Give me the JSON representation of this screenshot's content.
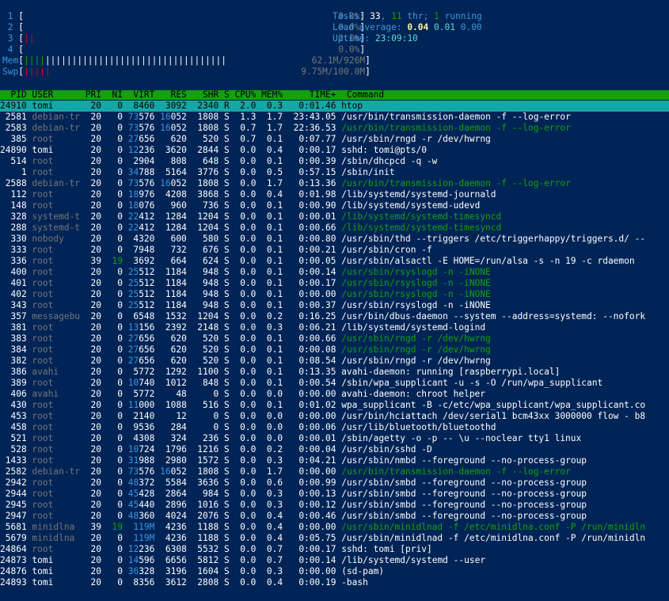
{
  "meters": {
    "cpus": [
      {
        "n": "1",
        "bar": "",
        "pct": "0.0%"
      },
      {
        "n": "2",
        "bar": "",
        "pct": "0.0%"
      },
      {
        "n": "3",
        "bar": "||",
        "pct": "2.0%"
      },
      {
        "n": "4",
        "bar": "",
        "pct": "0.0%"
      }
    ],
    "mem": {
      "label": "Mem",
      "bar": "||||||||||||||||||||||||||||||||||||||",
      "value": "62.1M/926M"
    },
    "swp": {
      "label": "Swp",
      "bar": "|||||",
      "value": "9.75M/100.0M"
    }
  },
  "summary": {
    "tasks_label": "Tasks:",
    "tasks": "33",
    "thr": "11",
    "thr_label": "thr;",
    "running": "1",
    "running_label": "running",
    "load_label": "Load average:",
    "load1": "0.04",
    "load5": "0.01",
    "load15": "0.00",
    "uptime_label": "Uptime:",
    "uptime": "23:09:10"
  },
  "columns": [
    "PID",
    "USER",
    "PRI",
    "NI",
    "VIRT",
    "RES",
    "SHR",
    "S",
    "CPU%",
    "MEM%",
    "TIME+",
    "Command"
  ],
  "processes": [
    [
      "24910",
      "tomi",
      "20",
      "0",
      "8460",
      "3092",
      "2340",
      "R",
      "2.0",
      "0.3",
      "0:01.46",
      "htop"
    ],
    [
      "2581",
      "debian-tr",
      "20",
      "0",
      "73576",
      "16052",
      "1808",
      "S",
      "1.3",
      "1.7",
      "23:43.05",
      "/usr/bin/transmission-daemon -f --log-error"
    ],
    [
      "2583",
      "debian-tr",
      "20",
      "0",
      "73576",
      "16052",
      "1808",
      "S",
      "0.7",
      "1.7",
      "22:36.53",
      "/usr/bin/transmission-daemon -f --log-error"
    ],
    [
      "385",
      "root",
      "20",
      "0",
      "27656",
      "620",
      "520",
      "S",
      "0.7",
      "0.1",
      "0:07.77",
      "/usr/sbin/rngd -r /dev/hwrng"
    ],
    [
      "24890",
      "tomi",
      "20",
      "0",
      "12236",
      "3620",
      "2844",
      "S",
      "0.0",
      "0.4",
      "0:00.17",
      "sshd: tomi@pts/0"
    ],
    [
      "514",
      "root",
      "20",
      "0",
      "2904",
      "808",
      "648",
      "S",
      "0.0",
      "0.1",
      "0:00.39",
      "/sbin/dhcpcd -q -w"
    ],
    [
      "1",
      "root",
      "20",
      "0",
      "34788",
      "5164",
      "3776",
      "S",
      "0.0",
      "0.5",
      "0:57.15",
      "/sbin/init"
    ],
    [
      "2588",
      "debian-tr",
      "20",
      "0",
      "73576",
      "16052",
      "1808",
      "S",
      "0.0",
      "1.7",
      "0:13.36",
      "/usr/bin/transmission-daemon -f --log-error"
    ],
    [
      "112",
      "root",
      "20",
      "0",
      "18976",
      "4208",
      "3868",
      "S",
      "0.0",
      "0.4",
      "0:01.98",
      "/lib/systemd/systemd-journald"
    ],
    [
      "148",
      "root",
      "20",
      "0",
      "18076",
      "960",
      "736",
      "S",
      "0.0",
      "0.1",
      "0:00.90",
      "/lib/systemd/systemd-udevd"
    ],
    [
      "328",
      "systemd-t",
      "20",
      "0",
      "22412",
      "1284",
      "1204",
      "S",
      "0.0",
      "0.1",
      "0:00.01",
      "/lib/systemd/systemd-timesyncd"
    ],
    [
      "288",
      "systemd-t",
      "20",
      "0",
      "22412",
      "1284",
      "1204",
      "S",
      "0.0",
      "0.1",
      "0:00.66",
      "/lib/systemd/systemd-timesyncd"
    ],
    [
      "330",
      "nobody",
      "20",
      "0",
      "4320",
      "600",
      "580",
      "S",
      "0.0",
      "0.1",
      "0:00.80",
      "/usr/sbin/thd --triggers /etc/triggerhappy/triggers.d/ --"
    ],
    [
      "333",
      "root",
      "20",
      "0",
      "7948",
      "732",
      "676",
      "S",
      "0.0",
      "0.1",
      "0:00.21",
      "/usr/sbin/cron -f"
    ],
    [
      "336",
      "root",
      "39",
      "19",
      "3692",
      "664",
      "624",
      "S",
      "0.0",
      "0.1",
      "0:00.05",
      "/usr/sbin/alsactl -E HOME=/run/alsa -s -n 19 -c rdaemon"
    ],
    [
      "400",
      "root",
      "20",
      "0",
      "25512",
      "1184",
      "948",
      "S",
      "0.0",
      "0.1",
      "0:00.14",
      "/usr/sbin/rsyslogd -n -iNONE"
    ],
    [
      "401",
      "root",
      "20",
      "0",
      "25512",
      "1184",
      "948",
      "S",
      "0.0",
      "0.1",
      "0:00.17",
      "/usr/sbin/rsyslogd -n -iNONE"
    ],
    [
      "402",
      "root",
      "20",
      "0",
      "25512",
      "1184",
      "948",
      "S",
      "0.0",
      "0.1",
      "0:00.00",
      "/usr/sbin/rsyslogd -n -iNONE"
    ],
    [
      "343",
      "root",
      "20",
      "0",
      "25512",
      "1184",
      "948",
      "S",
      "0.0",
      "0.1",
      "0:00.37",
      "/usr/sbin/rsyslogd -n -iNONE"
    ],
    [
      "357",
      "messagebu",
      "20",
      "0",
      "6548",
      "1532",
      "1204",
      "S",
      "0.0",
      "0.2",
      "0:16.25",
      "/usr/bin/dbus-daemon --system --address=systemd: --nofork"
    ],
    [
      "381",
      "root",
      "20",
      "0",
      "13156",
      "2392",
      "2148",
      "S",
      "0.0",
      "0.3",
      "0:06.21",
      "/lib/systemd/systemd-logind"
    ],
    [
      "383",
      "root",
      "20",
      "0",
      "27656",
      "620",
      "520",
      "S",
      "0.0",
      "0.1",
      "0:00.66",
      "/usr/sbin/rngd -r /dev/hwrng"
    ],
    [
      "384",
      "root",
      "20",
      "0",
      "27656",
      "620",
      "520",
      "S",
      "0.0",
      "0.1",
      "0:00.08",
      "/usr/sbin/rngd -r /dev/hwrng"
    ],
    [
      "382",
      "root",
      "20",
      "0",
      "27656",
      "620",
      "520",
      "S",
      "0.0",
      "0.1",
      "0:08.54",
      "/usr/sbin/rngd -r /dev/hwrng"
    ],
    [
      "386",
      "avahi",
      "20",
      "0",
      "5772",
      "1292",
      "1100",
      "S",
      "0.0",
      "0.1",
      "0:13.35",
      "avahi-daemon: running [raspberrypi.local]"
    ],
    [
      "389",
      "root",
      "20",
      "0",
      "10740",
      "1012",
      "848",
      "S",
      "0.0",
      "0.1",
      "0:00.54",
      "/sbin/wpa_supplicant -u -s -O /run/wpa_supplicant"
    ],
    [
      "406",
      "avahi",
      "20",
      "0",
      "5772",
      "48",
      "0",
      "S",
      "0.0",
      "0.0",
      "0:00.00",
      "avahi-daemon: chroot helper"
    ],
    [
      "430",
      "root",
      "20",
      "0",
      "11000",
      "1088",
      "516",
      "S",
      "0.0",
      "0.1",
      "0:01.02",
      "wpa_supplicant -B -c/etc/wpa_supplicant/wpa_supplicant.co"
    ],
    [
      "453",
      "root",
      "20",
      "0",
      "2140",
      "12",
      "0",
      "S",
      "0.0",
      "0.0",
      "0:00.00",
      "/usr/bin/hciattach /dev/serial1 bcm43xx 3000000 flow - b8"
    ],
    [
      "458",
      "root",
      "20",
      "0",
      "9536",
      "284",
      "0",
      "S",
      "0.0",
      "0.0",
      "0:00.06",
      "/usr/lib/bluetooth/bluetoothd"
    ],
    [
      "521",
      "root",
      "20",
      "0",
      "4308",
      "324",
      "236",
      "S",
      "0.0",
      "0.0",
      "0:00.01",
      "/sbin/agetty -o -p -- \\u --noclear tty1 linux"
    ],
    [
      "528",
      "root",
      "20",
      "0",
      "10724",
      "1796",
      "1216",
      "S",
      "0.0",
      "0.2",
      "0:00.04",
      "/usr/sbin/sshd -D"
    ],
    [
      "1433",
      "root",
      "20",
      "0",
      "31988",
      "2980",
      "1572",
      "S",
      "0.0",
      "0.3",
      "0:04.21",
      "/usr/sbin/nmbd --foreground --no-process-group"
    ],
    [
      "2582",
      "debian-tr",
      "20",
      "0",
      "73576",
      "16052",
      "1808",
      "S",
      "0.0",
      "1.7",
      "0:00.00",
      "/usr/bin/transmission-daemon -f --log-error"
    ],
    [
      "2942",
      "root",
      "20",
      "0",
      "48372",
      "5584",
      "3636",
      "S",
      "0.0",
      "0.6",
      "0:00.99",
      "/usr/sbin/smbd --foreground --no-process-group"
    ],
    [
      "2944",
      "root",
      "20",
      "0",
      "45428",
      "2864",
      "984",
      "S",
      "0.0",
      "0.3",
      "0:00.13",
      "/usr/sbin/smbd --foreground --no-process-group"
    ],
    [
      "2945",
      "root",
      "20",
      "0",
      "45440",
      "2896",
      "1016",
      "S",
      "0.0",
      "0.3",
      "0:00.12",
      "/usr/sbin/smbd --foreground --no-process-group"
    ],
    [
      "2947",
      "root",
      "20",
      "0",
      "48360",
      "4024",
      "2076",
      "S",
      "0.0",
      "0.4",
      "0:00.46",
      "/usr/sbin/smbd --foreground --no-process-group"
    ],
    [
      "5681",
      "minidlna",
      "39",
      "19",
      "119M",
      "4236",
      "1188",
      "S",
      "0.0",
      "0.4",
      "0:00.00",
      "/usr/sbin/minidlnad -f /etc/minidlna.conf -P /run/minidln"
    ],
    [
      "5679",
      "minidlna",
      "20",
      "0",
      "119M",
      "4236",
      "1188",
      "S",
      "0.0",
      "0.4",
      "0:05.75",
      "/usr/sbin/minidlnad -f /etc/minidlna.conf -P /run/minidln"
    ],
    [
      "24864",
      "root",
      "20",
      "0",
      "12236",
      "6308",
      "5532",
      "S",
      "0.0",
      "0.7",
      "0:00.17",
      "sshd: tomi [priv]"
    ],
    [
      "24873",
      "tomi",
      "20",
      "0",
      "14596",
      "6656",
      "5812",
      "S",
      "0.0",
      "0.7",
      "0:00.14",
      "/lib/systemd/systemd --user"
    ],
    [
      "24876",
      "tomi",
      "20",
      "0",
      "36328",
      "3196",
      "1604",
      "S",
      "0.0",
      "0.3",
      "0:00.00",
      "(sd-pam)"
    ],
    [
      "24893",
      "tomi",
      "20",
      "0",
      "8356",
      "3612",
      "2808",
      "S",
      "0.0",
      "0.4",
      "0:00.19",
      "-bash"
    ]
  ],
  "thread_rows": [
    2,
    7,
    10,
    11,
    15,
    16,
    17,
    21,
    22,
    33,
    38
  ],
  "colors": {
    "background": "#012456",
    "header_bar": "#13a10e",
    "selected_row": "#16a6a6",
    "cyan": "#3a96dd",
    "green": "#13a10e",
    "red": "#c50f1f",
    "yellow": "#f9f1a5"
  }
}
